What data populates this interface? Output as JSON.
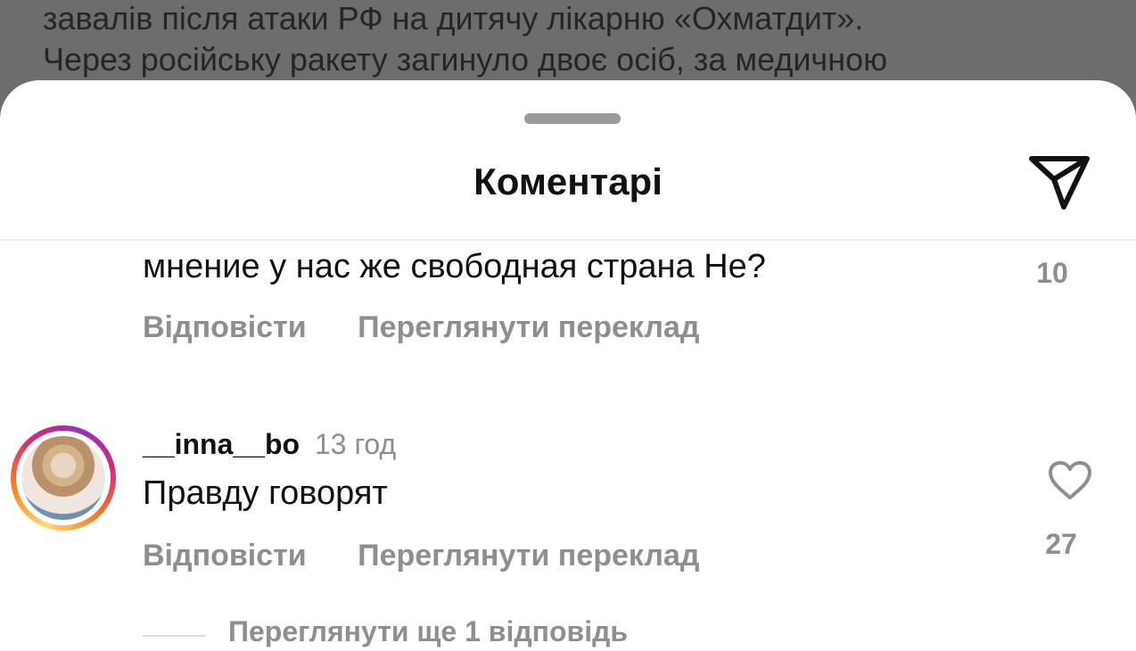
{
  "background_post": {
    "lines": [
      "завалів після атаки РФ на дитячу лікарню «Охматдит».",
      "Через російську ракету загинуло двоє осіб, за медичною"
    ]
  },
  "header": {
    "title": "Коментарі",
    "share_icon": "send-paper-plane-icon"
  },
  "comments": [
    {
      "text": "мнение у нас же свободная страна Не?",
      "reply_label": "Відповісти",
      "translate_label": "Переглянути переклад",
      "likes": "10"
    },
    {
      "username": "__inna__bo",
      "time": "13 год",
      "text": "Правду говорят",
      "reply_label": "Відповісти",
      "translate_label": "Переглянути переклад",
      "likes": "27",
      "like_icon": "heart-icon"
    }
  ],
  "view_replies": "Переглянути ще 1 відповідь",
  "colors": {
    "overlay": "#6d6d6d",
    "sheet": "#ffffff",
    "secondary_text": "#8e8e8e",
    "primary_text": "#111111"
  }
}
